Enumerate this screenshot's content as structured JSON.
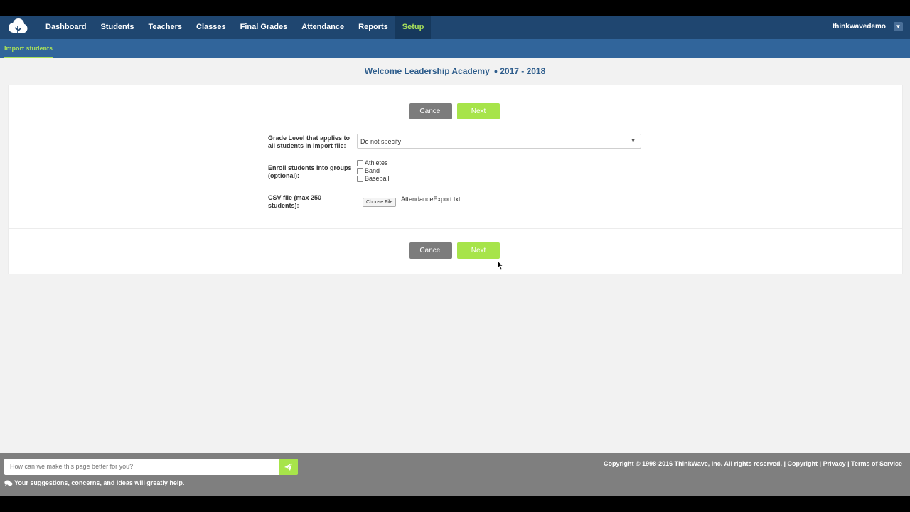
{
  "nav": {
    "items": [
      {
        "label": "Dashboard",
        "name": "nav-dashboard",
        "active": false
      },
      {
        "label": "Students",
        "name": "nav-students",
        "active": false
      },
      {
        "label": "Teachers",
        "name": "nav-teachers",
        "active": false
      },
      {
        "label": "Classes",
        "name": "nav-classes",
        "active": false
      },
      {
        "label": "Final Grades",
        "name": "nav-final-grades",
        "active": false
      },
      {
        "label": "Attendance",
        "name": "nav-attendance",
        "active": false
      },
      {
        "label": "Reports",
        "name": "nav-reports",
        "active": false
      },
      {
        "label": "Setup",
        "name": "nav-setup",
        "active": true
      }
    ],
    "user": "thinkwavedemo",
    "user_menu_icon": "chevron-down-icon"
  },
  "subnav": {
    "active_label": "Import students"
  },
  "welcome": {
    "school": "Welcome Leadership Academy",
    "year": "2017 - 2018"
  },
  "form": {
    "cancel_label": "Cancel",
    "next_label": "Next",
    "grade_label": "Grade Level that applies to all students in import file:",
    "grade_value": "Do not specify",
    "groups_label": "Enroll students into groups (optional):",
    "groups": [
      "Athletes",
      "Band",
      "Baseball"
    ],
    "csv_label": "CSV file (max 250 students):",
    "choose_file_label": "Choose File",
    "file_name": "AttendanceExport.txt"
  },
  "footer": {
    "feedback_placeholder": "How can we make this page better for you?",
    "feedback_note": "Your suggestions, concerns, and ideas will greatly help.",
    "copyright": "Copyright © 1998-2016 ThinkWave, Inc. All rights reserved.",
    "links": [
      "Copyright",
      "Privacy",
      "Terms of Service"
    ]
  },
  "colors": {
    "nav_bg": "#1f4670",
    "subnav_bg": "#31659b",
    "accent_green": "#a7e44a",
    "cancel_gray": "#7c7c7c",
    "footer_bg": "#7f7f7f",
    "title_blue": "#2e5d8c"
  }
}
